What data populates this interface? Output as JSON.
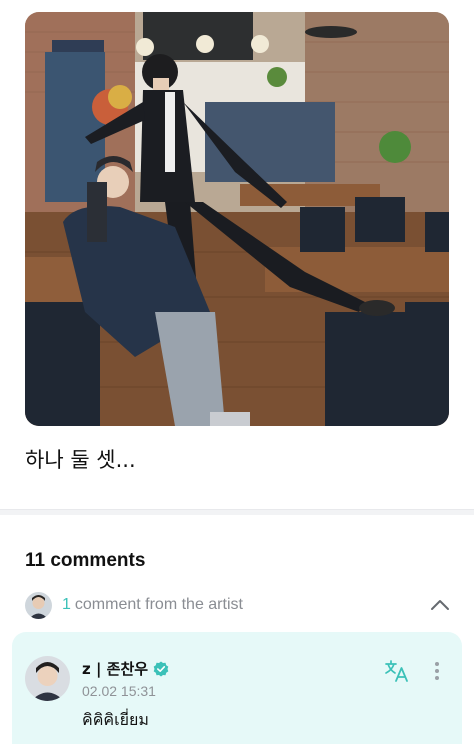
{
  "post": {
    "image_icon": "cafe-photo",
    "caption": "하나 둘 셋..."
  },
  "comments": {
    "count_label": "11 comments",
    "artist_summary": {
      "count": "1",
      "label": "comment from the artist",
      "toggle_icon": "chevron-up-icon"
    },
    "items": [
      {
        "author": "z | 존찬우",
        "verified_icon": "verified-badge-icon",
        "timestamp": "02.02 15:31",
        "text": "คิคิคิเยี่ยม",
        "translate_icon": "translate-icon",
        "more_icon": "more-vertical-icon"
      }
    ]
  },
  "colors": {
    "accent": "#3bc1b8",
    "card_background": "#e6f9f8",
    "muted_text": "#8a8d93"
  }
}
